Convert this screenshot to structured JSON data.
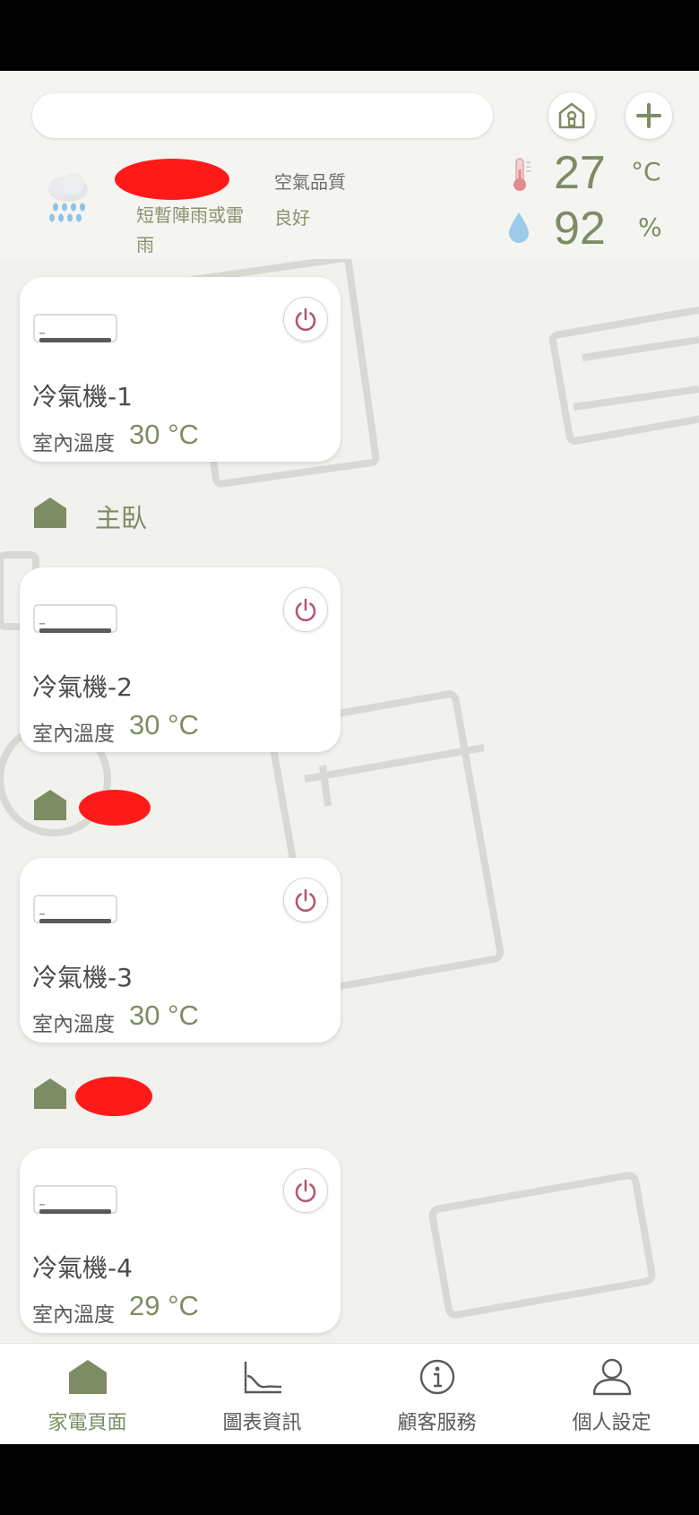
{
  "header": {
    "search_placeholder": "",
    "weather": {
      "description": "短暫陣雨或雷雨"
    },
    "air_quality": {
      "label": "空氣品質",
      "value": "良好"
    },
    "temperature": {
      "value": "27",
      "unit": "°C"
    },
    "humidity": {
      "value": "92",
      "unit": "%"
    }
  },
  "devices": [
    {
      "name": "冷氣機-1",
      "temp_label": "室內溫度",
      "temp_value": "30 °C"
    },
    {
      "name": "冷氣機-2",
      "temp_label": "室內溫度",
      "temp_value": "30 °C"
    },
    {
      "name": "冷氣機-3",
      "temp_label": "室內溫度",
      "temp_value": "30 °C"
    },
    {
      "name": "冷氣機-4",
      "temp_label": "室內溫度",
      "temp_value": "29 °C"
    }
  ],
  "rooms": [
    {
      "name": "主臥"
    }
  ],
  "nav": {
    "items": [
      {
        "label": "家電頁面",
        "icon": "house-icon",
        "active": true
      },
      {
        "label": "圖表資訊",
        "icon": "chart-icon",
        "active": false
      },
      {
        "label": "顧客服務",
        "icon": "info-icon",
        "active": false
      },
      {
        "label": "個人設定",
        "icon": "person-icon",
        "active": false
      }
    ]
  },
  "colors": {
    "accent": "#7e8c63",
    "power": "#b05a6e",
    "background": "#f1f1ed"
  }
}
